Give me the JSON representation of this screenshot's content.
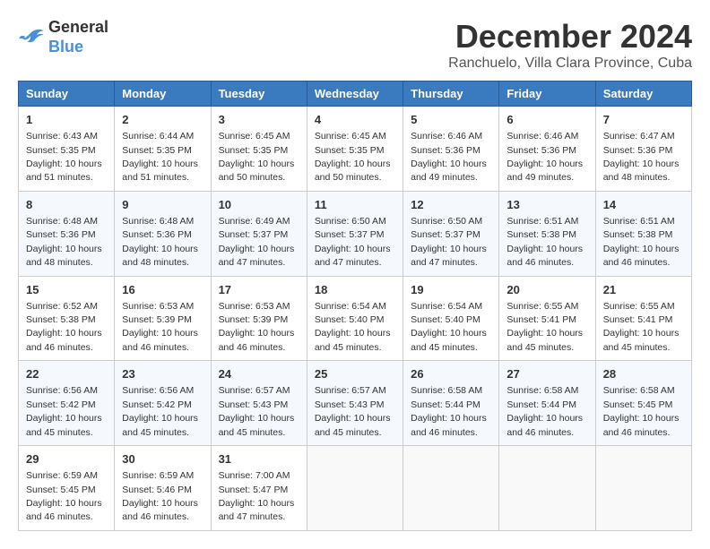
{
  "logo": {
    "line1": "General",
    "line2": "Blue"
  },
  "title": "December 2024",
  "location": "Ranchuelo, Villa Clara Province, Cuba",
  "weekdays": [
    "Sunday",
    "Monday",
    "Tuesday",
    "Wednesday",
    "Thursday",
    "Friday",
    "Saturday"
  ],
  "weeks": [
    [
      {
        "day": "1",
        "sunrise": "6:43 AM",
        "sunset": "5:35 PM",
        "daylight": "10 hours and 51 minutes."
      },
      {
        "day": "2",
        "sunrise": "6:44 AM",
        "sunset": "5:35 PM",
        "daylight": "10 hours and 51 minutes."
      },
      {
        "day": "3",
        "sunrise": "6:45 AM",
        "sunset": "5:35 PM",
        "daylight": "10 hours and 50 minutes."
      },
      {
        "day": "4",
        "sunrise": "6:45 AM",
        "sunset": "5:35 PM",
        "daylight": "10 hours and 50 minutes."
      },
      {
        "day": "5",
        "sunrise": "6:46 AM",
        "sunset": "5:36 PM",
        "daylight": "10 hours and 49 minutes."
      },
      {
        "day": "6",
        "sunrise": "6:46 AM",
        "sunset": "5:36 PM",
        "daylight": "10 hours and 49 minutes."
      },
      {
        "day": "7",
        "sunrise": "6:47 AM",
        "sunset": "5:36 PM",
        "daylight": "10 hours and 48 minutes."
      }
    ],
    [
      {
        "day": "8",
        "sunrise": "6:48 AM",
        "sunset": "5:36 PM",
        "daylight": "10 hours and 48 minutes."
      },
      {
        "day": "9",
        "sunrise": "6:48 AM",
        "sunset": "5:36 PM",
        "daylight": "10 hours and 48 minutes."
      },
      {
        "day": "10",
        "sunrise": "6:49 AM",
        "sunset": "5:37 PM",
        "daylight": "10 hours and 47 minutes."
      },
      {
        "day": "11",
        "sunrise": "6:50 AM",
        "sunset": "5:37 PM",
        "daylight": "10 hours and 47 minutes."
      },
      {
        "day": "12",
        "sunrise": "6:50 AM",
        "sunset": "5:37 PM",
        "daylight": "10 hours and 47 minutes."
      },
      {
        "day": "13",
        "sunrise": "6:51 AM",
        "sunset": "5:38 PM",
        "daylight": "10 hours and 46 minutes."
      },
      {
        "day": "14",
        "sunrise": "6:51 AM",
        "sunset": "5:38 PM",
        "daylight": "10 hours and 46 minutes."
      }
    ],
    [
      {
        "day": "15",
        "sunrise": "6:52 AM",
        "sunset": "5:38 PM",
        "daylight": "10 hours and 46 minutes."
      },
      {
        "day": "16",
        "sunrise": "6:53 AM",
        "sunset": "5:39 PM",
        "daylight": "10 hours and 46 minutes."
      },
      {
        "day": "17",
        "sunrise": "6:53 AM",
        "sunset": "5:39 PM",
        "daylight": "10 hours and 46 minutes."
      },
      {
        "day": "18",
        "sunrise": "6:54 AM",
        "sunset": "5:40 PM",
        "daylight": "10 hours and 45 minutes."
      },
      {
        "day": "19",
        "sunrise": "6:54 AM",
        "sunset": "5:40 PM",
        "daylight": "10 hours and 45 minutes."
      },
      {
        "day": "20",
        "sunrise": "6:55 AM",
        "sunset": "5:41 PM",
        "daylight": "10 hours and 45 minutes."
      },
      {
        "day": "21",
        "sunrise": "6:55 AM",
        "sunset": "5:41 PM",
        "daylight": "10 hours and 45 minutes."
      }
    ],
    [
      {
        "day": "22",
        "sunrise": "6:56 AM",
        "sunset": "5:42 PM",
        "daylight": "10 hours and 45 minutes."
      },
      {
        "day": "23",
        "sunrise": "6:56 AM",
        "sunset": "5:42 PM",
        "daylight": "10 hours and 45 minutes."
      },
      {
        "day": "24",
        "sunrise": "6:57 AM",
        "sunset": "5:43 PM",
        "daylight": "10 hours and 45 minutes."
      },
      {
        "day": "25",
        "sunrise": "6:57 AM",
        "sunset": "5:43 PM",
        "daylight": "10 hours and 45 minutes."
      },
      {
        "day": "26",
        "sunrise": "6:58 AM",
        "sunset": "5:44 PM",
        "daylight": "10 hours and 46 minutes."
      },
      {
        "day": "27",
        "sunrise": "6:58 AM",
        "sunset": "5:44 PM",
        "daylight": "10 hours and 46 minutes."
      },
      {
        "day": "28",
        "sunrise": "6:58 AM",
        "sunset": "5:45 PM",
        "daylight": "10 hours and 46 minutes."
      }
    ],
    [
      {
        "day": "29",
        "sunrise": "6:59 AM",
        "sunset": "5:45 PM",
        "daylight": "10 hours and 46 minutes."
      },
      {
        "day": "30",
        "sunrise": "6:59 AM",
        "sunset": "5:46 PM",
        "daylight": "10 hours and 46 minutes."
      },
      {
        "day": "31",
        "sunrise": "7:00 AM",
        "sunset": "5:47 PM",
        "daylight": "10 hours and 47 minutes."
      },
      null,
      null,
      null,
      null
    ]
  ],
  "labels": {
    "sunrise": "Sunrise:",
    "sunset": "Sunset:",
    "daylight": "Daylight:"
  }
}
